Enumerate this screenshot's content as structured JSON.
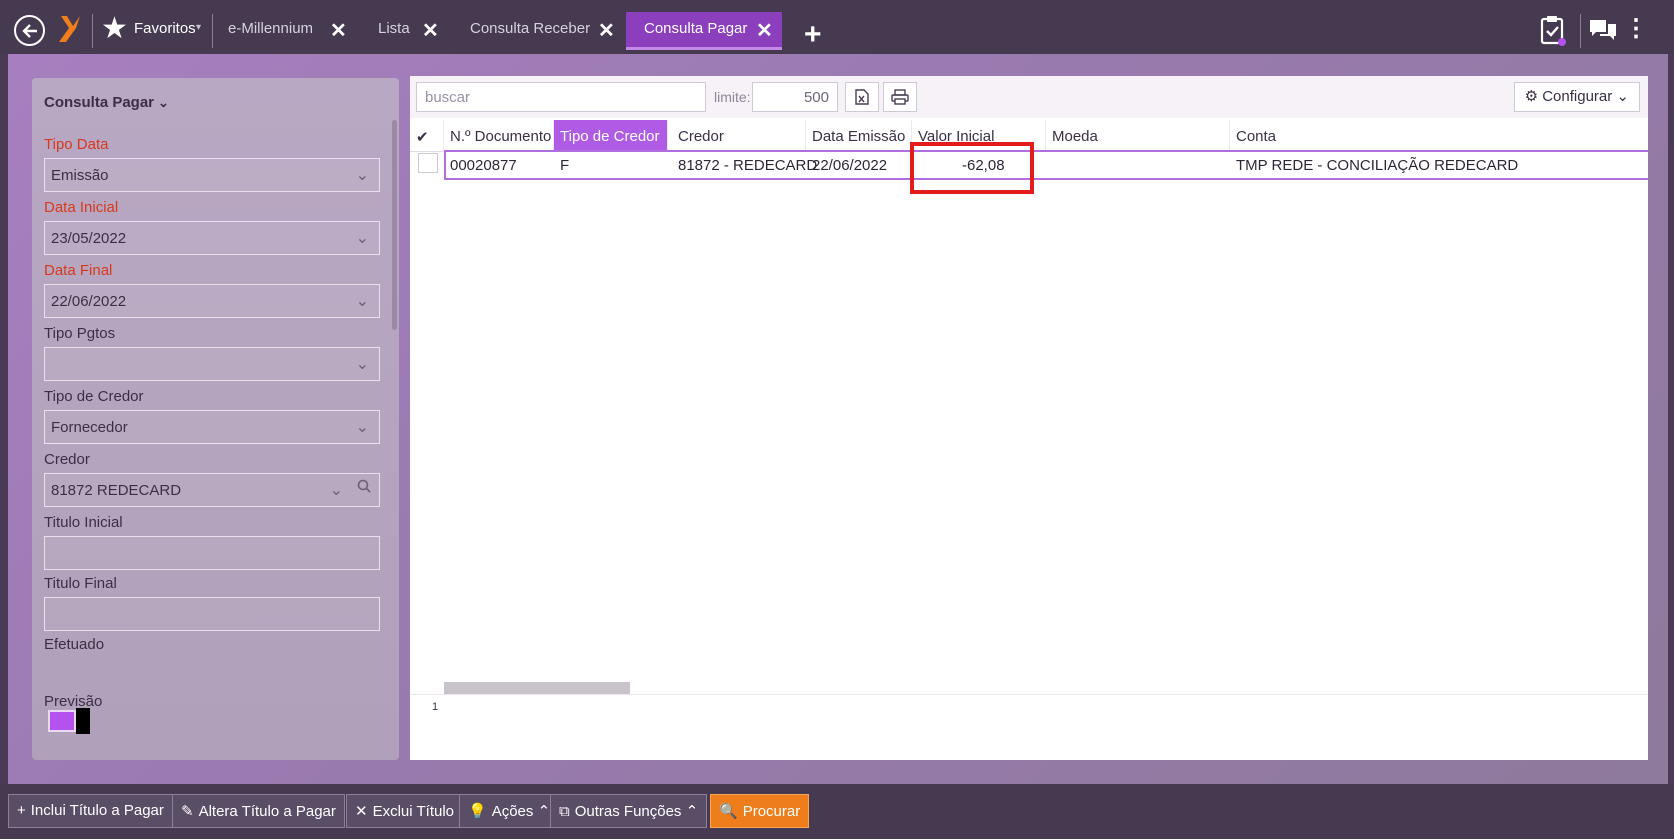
{
  "topbar": {
    "favorites_label": "Favoritos",
    "tabs": [
      {
        "label": "e-Millennium",
        "active": false
      },
      {
        "label": "Lista",
        "active": false
      },
      {
        "label": "Consulta Receber",
        "active": false
      },
      {
        "label": "Consulta Pagar",
        "active": true
      }
    ],
    "icons": [
      "back-icon",
      "logo",
      "star-icon",
      "close-icon",
      "plus-icon",
      "clipboard-check-icon",
      "chat-icon",
      "more-vertical-icon"
    ]
  },
  "left_panel": {
    "title": "Consulta Pagar",
    "fields": {
      "tipo_data": {
        "label": "Tipo Data",
        "value": "Emissão"
      },
      "data_inicial": {
        "label": "Data Inicial",
        "value": "23/05/2022"
      },
      "data_final": {
        "label": "Data Final",
        "value": "22/06/2022"
      },
      "tipo_pgtos": {
        "label": "Tipo Pgtos",
        "value": ""
      },
      "tipo_credor": {
        "label": "Tipo de Credor",
        "value": "Fornecedor"
      },
      "credor": {
        "label": "Credor",
        "value": "81872 REDECARD"
      },
      "titulo_inicial": {
        "label": "Titulo Inicial",
        "value": ""
      },
      "titulo_final": {
        "label": "Titulo Final",
        "value": ""
      },
      "efetuado": {
        "label": "Efetuado",
        "checked": true
      },
      "previsao": {
        "label": "Previsão",
        "checked": false
      }
    }
  },
  "toolbar": {
    "search_placeholder": "buscar",
    "limit_label": "limite:",
    "limit_value": "500",
    "config_label": "Configurar"
  },
  "grid": {
    "columns": [
      "N.º Documento",
      "Tipo de Credor",
      "Credor",
      "Data Emissão",
      "Valor Inicial",
      "Moeda",
      "Conta"
    ],
    "sorted_column": "Tipo de Credor",
    "rows": [
      {
        "documento": "00020877",
        "tipo_credor": "F",
        "credor": "81872 - REDECARD",
        "data_emissao": "22/06/2022",
        "valor_inicial": "-62,08",
        "moeda": "",
        "conta": "TMP REDE - CONCILIAÇÃO REDECARD"
      }
    ],
    "page": "1"
  },
  "actions": [
    {
      "label": "Inclui Título a Pagar",
      "icon": "plus-icon"
    },
    {
      "label": "Altera Título a Pagar",
      "icon": "edit-icon"
    },
    {
      "label": "Exclui Título",
      "icon": "close-icon"
    },
    {
      "label": "Ações",
      "icon": "lightbulb-icon"
    },
    {
      "label": "Outras Funções",
      "icon": "external-edit-icon"
    },
    {
      "label": "Procurar",
      "icon": "search-icon"
    }
  ],
  "colors": {
    "accent": "#b05be6",
    "primary_action": "#ee7d1c",
    "highlight": "#e31b1b",
    "required_label": "#d7391c"
  }
}
